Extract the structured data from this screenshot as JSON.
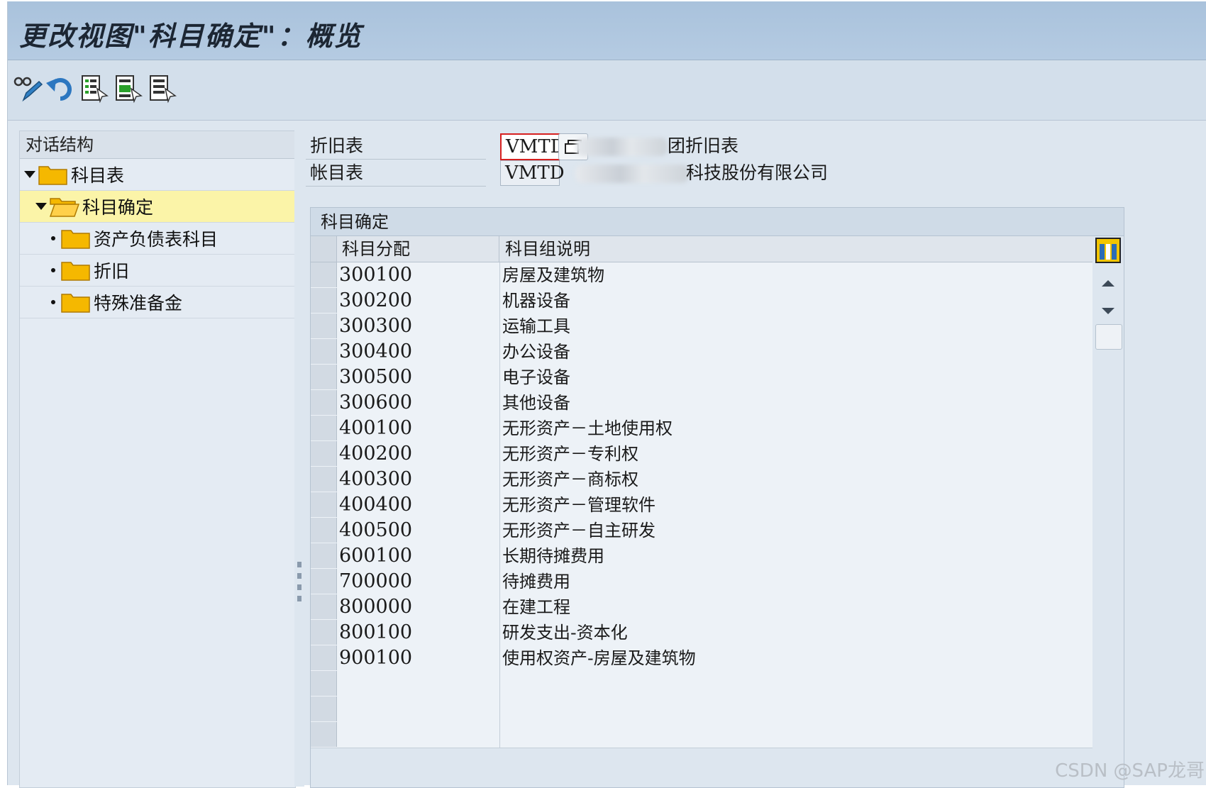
{
  "window": {
    "title": "更改视图\"科目确定\"：概览"
  },
  "toolbar": {
    "buttons": [
      {
        "icon": "glasses-pencil-icon"
      },
      {
        "icon": "undo-icon"
      },
      {
        "icon": "select-all-icon"
      },
      {
        "icon": "select-block-icon"
      },
      {
        "icon": "deselect-all-icon"
      }
    ]
  },
  "tree": {
    "header": "对话结构",
    "items": [
      {
        "label": "科目表",
        "level": 0,
        "expanded": true
      },
      {
        "label": "科目确定",
        "level": 1,
        "expanded": true,
        "selected": true
      },
      {
        "label": "资产负债表科目",
        "level": 2
      },
      {
        "label": "折旧",
        "level": 2
      },
      {
        "label": "特殊准备金",
        "level": 2
      }
    ]
  },
  "fields": {
    "dep_table": {
      "label": "折旧表",
      "value": "VMTD",
      "desc": "团折旧表"
    },
    "coa": {
      "label": "帐目表",
      "value": "VMTD",
      "desc": "科技股份有限公司"
    }
  },
  "table": {
    "title": "科目确定",
    "columns": [
      "科目分配",
      "科目组说明"
    ],
    "rows": [
      {
        "code": "300100",
        "desc": "房屋及建筑物"
      },
      {
        "code": "300200",
        "desc": "机器设备"
      },
      {
        "code": "300300",
        "desc": "运输工具"
      },
      {
        "code": "300400",
        "desc": "办公设备"
      },
      {
        "code": "300500",
        "desc": "电子设备"
      },
      {
        "code": "300600",
        "desc": "其他设备"
      },
      {
        "code": "400100",
        "desc": "无形资产－土地使用权"
      },
      {
        "code": "400200",
        "desc": "无形资产－专利权"
      },
      {
        "code": "400300",
        "desc": "无形资产－商标权"
      },
      {
        "code": "400400",
        "desc": "无形资产－管理软件"
      },
      {
        "code": "400500",
        "desc": "无形资产－自主研发"
      },
      {
        "code": "600100",
        "desc": "长期待摊费用"
      },
      {
        "code": "700000",
        "desc": "待摊费用"
      },
      {
        "code": "800000",
        "desc": "在建工程"
      },
      {
        "code": "800100",
        "desc": "研发支出-资本化"
      },
      {
        "code": "900100",
        "desc": "使用权资产-房屋及建筑物"
      },
      {
        "code": "",
        "desc": ""
      },
      {
        "code": "",
        "desc": ""
      },
      {
        "code": "",
        "desc": ""
      }
    ]
  },
  "watermark": "CSDN @SAP龙哥",
  "colors": {
    "title_bar": "#a9c2dc",
    "selected_node": "#fbf4a8",
    "focus_border": "#d62020",
    "folder": "#f5b800"
  }
}
